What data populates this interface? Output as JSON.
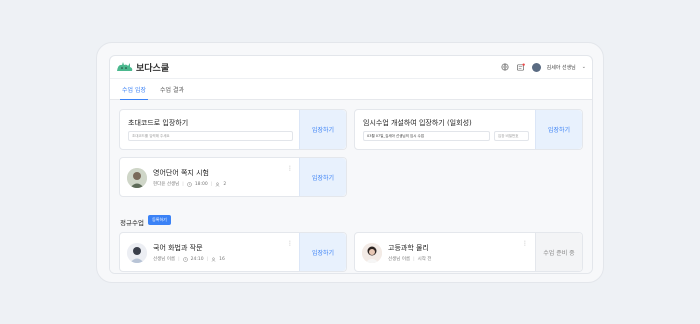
{
  "header": {
    "brand": "보다스쿨",
    "user_name": "김세아 선생님"
  },
  "tabs": [
    {
      "label": "수업 입장",
      "active": true
    },
    {
      "label": "수업 결과",
      "active": false
    }
  ],
  "code_card": {
    "title": "초대코드로 입장하기",
    "placeholder": "초대코드를 입력해 주세요",
    "button": "입장하기"
  },
  "temp_card": {
    "title": "임시수업 개설하여 입장하기 (일회성)",
    "value": "03월 07일_김세아 선생님의 임시 수업",
    "password_placeholder": "입장 비밀번호",
    "button": "입장하기"
  },
  "vocab_card": {
    "title": "영어단어 쪽지 시험",
    "teacher": "현다윤 선생님",
    "time": "18:00",
    "count": "2",
    "button": "입장하기"
  },
  "regular": {
    "title": "정규수업",
    "new_button": "등록하기",
    "cards": [
      {
        "title": "국어 화법과 작문",
        "teacher": "선생님 이름",
        "time": "24:10",
        "count": "16",
        "button": "입장하기",
        "enabled": true
      },
      {
        "title": "고등과학 물리",
        "teacher": "선생님 이름",
        "status": "시작 전",
        "button": "수업 준비 중",
        "enabled": false
      }
    ]
  },
  "colors": {
    "accent": "#3b82f6",
    "accent_soft": "#e8f1fd"
  }
}
